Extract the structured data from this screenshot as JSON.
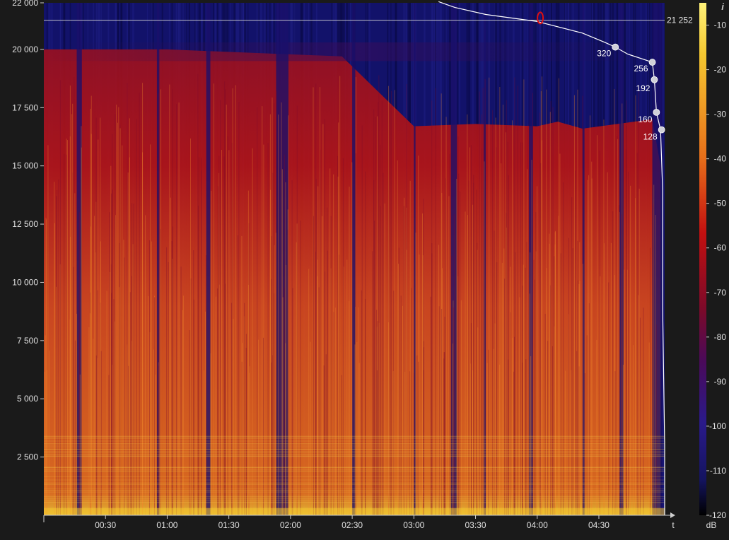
{
  "chart_data": {
    "type": "heatmap",
    "subtype": "spectrogram",
    "xlabel": "t",
    "ylabel": "",
    "xlim_seconds": [
      0,
      302
    ],
    "ylim": [
      0,
      22000
    ],
    "x_ticks": [
      "00:30",
      "01:00",
      "01:30",
      "02:00",
      "02:30",
      "03:00",
      "03:30",
      "04:00",
      "04:30"
    ],
    "y_ticks": [
      "2 500",
      "5 000",
      "7 500",
      "10 000",
      "12 500",
      "15 000",
      "17 500",
      "20 000",
      "22 000"
    ],
    "colorbar": {
      "unit": "dB",
      "ticks": [
        "-10",
        "-20",
        "-30",
        "-40",
        "-50",
        "-60",
        "-70",
        "-80",
        "-90",
        "-100",
        "-110",
        "-120"
      ],
      "range": [
        -120,
        -5
      ]
    },
    "reference_line": {
      "label": "21 252",
      "value": 21252
    },
    "cutoff_markers": [
      {
        "label": "320",
        "value": 20100
      },
      {
        "label": "256",
        "value": 19450
      },
      {
        "label": "192",
        "value": 18700
      },
      {
        "label": "160",
        "value": 17300
      },
      {
        "label": "128",
        "value": 16550
      }
    ],
    "colors": {
      "background": "#1a1a1a",
      "plot_dark": "#0f0f5a",
      "signal_red": "#c21010",
      "signal_orange": "#e8701a",
      "signal_yellow": "#f5c830",
      "curve": "#ffffff",
      "marker": "#d0d0d8",
      "highlight": "#e01010"
    },
    "info_icon": "info-icon"
  }
}
